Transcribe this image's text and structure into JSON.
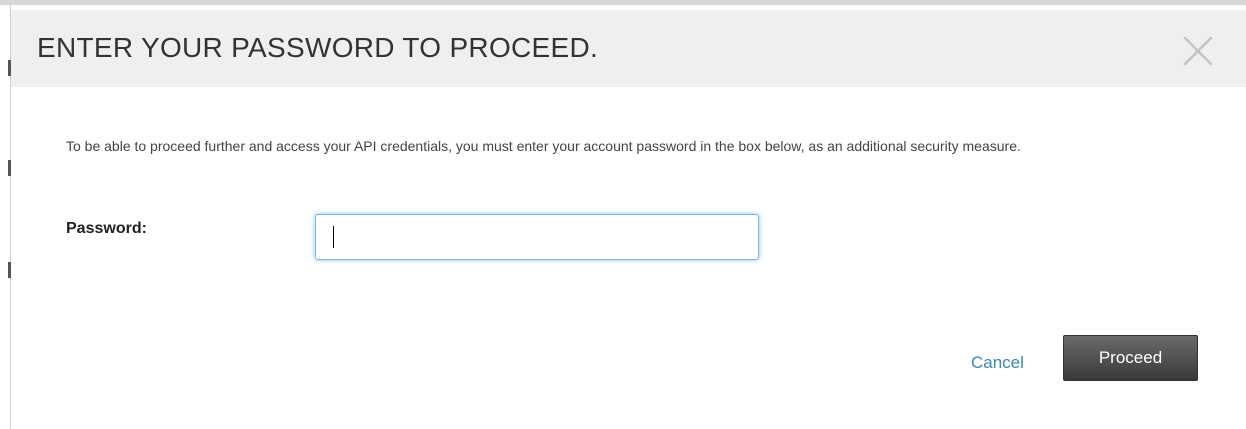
{
  "dialog": {
    "title": "ENTER YOUR PASSWORD TO PROCEED.",
    "close_icon": "close-icon",
    "intro_text": "To be able to proceed further and access your API credentials, you must enter your account password in the box below, as an additional security measure."
  },
  "form": {
    "password_label": "Password:",
    "password_value": "",
    "password_placeholder": ""
  },
  "actions": {
    "cancel_label": "Cancel",
    "proceed_label": "Proceed"
  },
  "colors": {
    "header_bg": "#efefef",
    "title_text": "#333333",
    "link": "#3a87b5",
    "input_focus": "#7eb6e3",
    "proceed_bg": "#4d4d4d"
  }
}
